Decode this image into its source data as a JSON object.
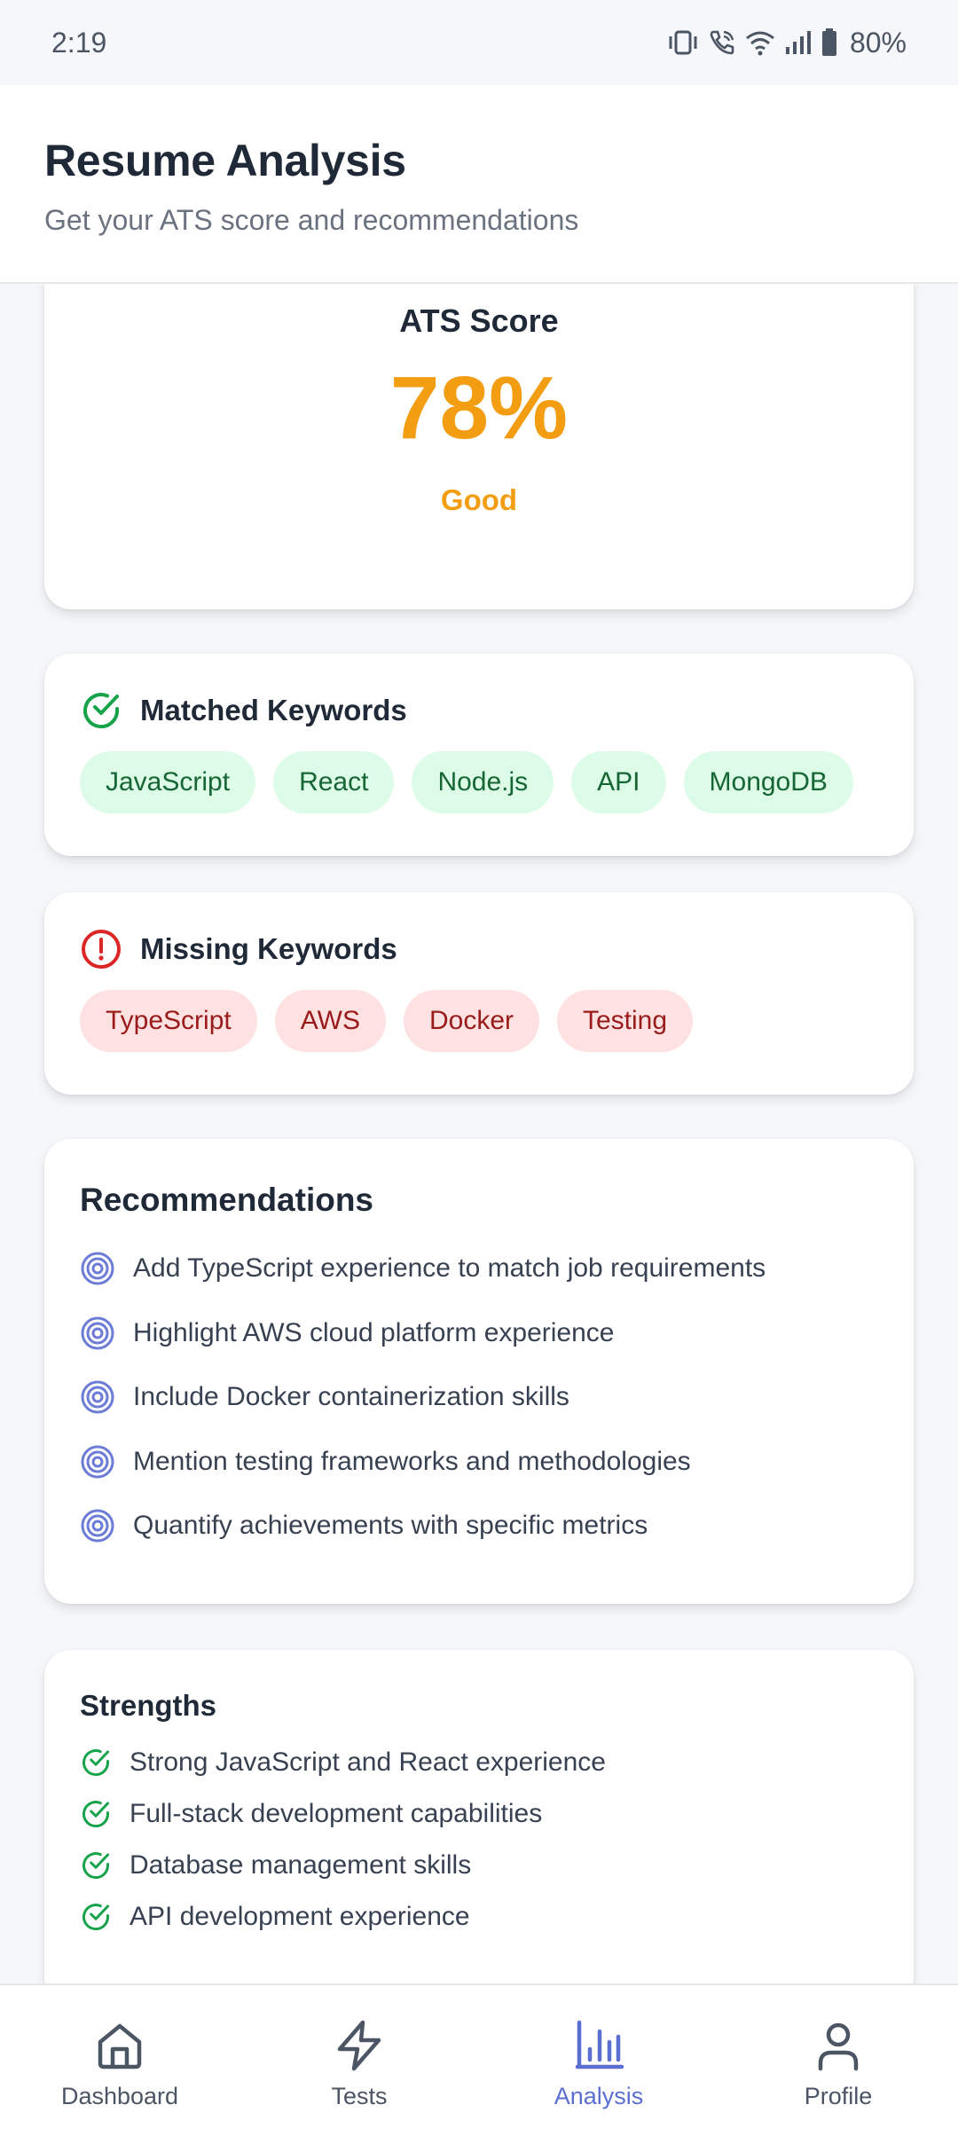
{
  "status_bar": {
    "time": "2:19",
    "battery": "80%",
    "icons": [
      "vibrate-icon",
      "wifi-call-icon",
      "wifi-icon",
      "signal-icon",
      "battery-icon"
    ]
  },
  "header": {
    "title": "Resume Analysis",
    "subtitle": "Get your ATS score and recommendations"
  },
  "ats": {
    "title": "ATS Score",
    "score": "78%",
    "score_value": 78,
    "rating": "Good",
    "color": "#f29d12"
  },
  "matched": {
    "title": "Matched Keywords",
    "keywords": [
      "JavaScript",
      "React",
      "Node.js",
      "API",
      "MongoDB"
    ]
  },
  "missing": {
    "title": "Missing Keywords",
    "keywords": [
      "TypeScript",
      "AWS",
      "Docker",
      "Testing"
    ]
  },
  "recommendations": {
    "title": "Recommendations",
    "items": [
      "Add TypeScript experience to match job requirements",
      "Highlight AWS cloud platform experience",
      "Include Docker containerization skills",
      "Mention testing frameworks and methodologies",
      "Quantify achievements with specific metrics"
    ]
  },
  "strengths": {
    "title": "Strengths",
    "items": [
      "Strong JavaScript and React experience",
      "Full-stack development capabilities",
      "Database management skills",
      "API development experience"
    ]
  },
  "nav": {
    "items": [
      {
        "label": "Dashboard",
        "icon": "home-icon"
      },
      {
        "label": "Tests",
        "icon": "lightning-icon"
      },
      {
        "label": "Analysis",
        "icon": "bar-chart-icon"
      },
      {
        "label": "Profile",
        "icon": "user-icon"
      }
    ],
    "active": "Analysis",
    "active_color": "#5b6fd1"
  },
  "colors": {
    "green": "#16a34a",
    "red": "#dc2626",
    "target": "#6b7bd6"
  }
}
